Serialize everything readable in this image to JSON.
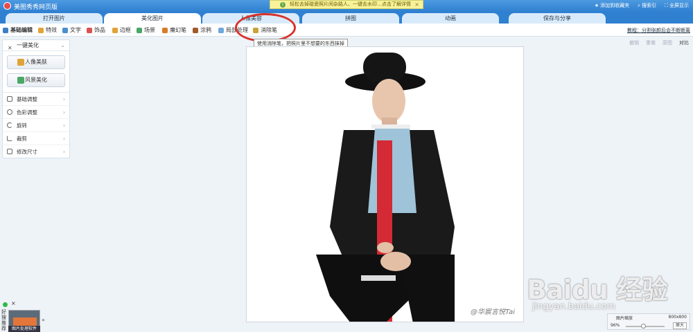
{
  "app": {
    "title": "美图秀秀网页版"
  },
  "notice": {
    "text": "轻松去掉碰瓷照片闲杂路人、一键去水印…点击了解详情",
    "close": "×"
  },
  "top_links": [
    {
      "label": "添加到收藏夹"
    },
    {
      "label": "搜索引"
    },
    {
      "label": "全屏显示"
    }
  ],
  "tabs": [
    {
      "label": "打开图片"
    },
    {
      "label": "美化图片"
    },
    {
      "label": "人像美容"
    },
    {
      "label": "拼图"
    },
    {
      "label": "动画"
    },
    {
      "label": "保存与分享"
    }
  ],
  "toolbar": {
    "tools": [
      {
        "label": "基础编辑",
        "color": "#3b7fc4"
      },
      {
        "label": "特效",
        "color": "#e0a33a"
      },
      {
        "label": "文字",
        "color": "#4a8fd0"
      },
      {
        "label": "饰品",
        "color": "#d9534f"
      },
      {
        "label": "边框",
        "color": "#e0a33a"
      },
      {
        "label": "场景",
        "color": "#4aa866"
      },
      {
        "label": "魔幻笔",
        "color": "#d77b2a"
      },
      {
        "label": "涂鸦",
        "color": "#a05a2c"
      },
      {
        "label": "局部处理",
        "color": "#6fa8dc"
      },
      {
        "label": "消除笔",
        "color": "#c9a33a"
      }
    ],
    "tutorial_link": "教程：分割张颜后会不断断离"
  },
  "tooltip": "使用消除笔，把照片里不想要的东西抹掉",
  "edit_tools": [
    {
      "label": "撤销"
    },
    {
      "label": "重做"
    },
    {
      "label": "原图"
    },
    {
      "label": "对比"
    }
  ],
  "sidebar": {
    "header": "一键美化",
    "buttons": [
      {
        "label": "人像美肤",
        "color": "#e0a33a"
      },
      {
        "label": "风景美化",
        "color": "#4aa866"
      }
    ],
    "items": [
      {
        "label": "基础调整"
      },
      {
        "label": "色彩调整"
      },
      {
        "label": "旋转"
      },
      {
        "label": "裁剪"
      },
      {
        "label": "修改尺寸"
      }
    ]
  },
  "photo": {
    "watermark": "@华宸言悦Tai"
  },
  "zoom": {
    "title": "图片缩放",
    "size": "800x800",
    "percent": "96%",
    "level": 0.45,
    "button": "原大"
  },
  "baidu": {
    "logo": "Baidu 经验",
    "url": "jingyan.baidu.com"
  },
  "ad": {
    "side_text": "好搜推荐",
    "caption": "图片处理软件"
  }
}
